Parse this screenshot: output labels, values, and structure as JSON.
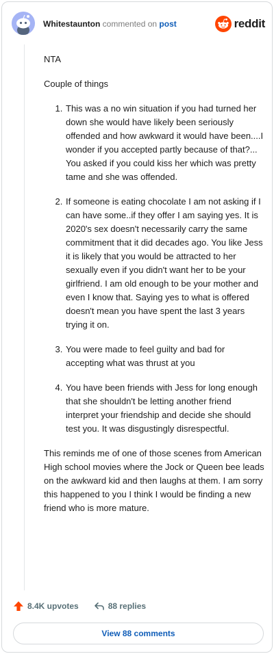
{
  "comment": {
    "username": "Whitestaunton",
    "action_text": "commented on",
    "post_link_label": "post",
    "paragraphs_before": [
      "NTA",
      "Couple of things"
    ],
    "list_items": [
      "This was a no win situation if you had turned her down she would have likely been seriously offended and how awkward it would have been....I wonder if you accepted partly because of that?... You asked if you could kiss her which was pretty tame and she was offended.",
      "If someone is eating chocolate I am not asking if I can have some..if they offer I am saying yes. It is 2020's sex doesn't necessarily carry the same commitment that it did decades ago. You like Jess it is likely that you would be attracted to her sexually even if you didn't want her to be your girlfriend. I am old enough to be your mother and even I know that. Saying yes to what is offered doesn't mean you have spent the last 3 years trying it on.",
      "You were made to feel guilty and bad for accepting what was thrust at you",
      "You have been friends with Jess for long enough that she shouldn't be letting another friend interpret your friendship and decide she should test you. It was disgustingly disrespectful."
    ],
    "closing_paragraph": "This reminds me of one of those scenes from American High school movies where the Jock or Queen bee leads on the awkward kid and then laughs at them. I am sorry this happened to you I think I would be finding a new friend who is more mature.",
    "upvotes_label": "8.4K upvotes",
    "replies_label": "88 replies",
    "view_comments_label": "View 88 comments"
  },
  "brand": {
    "name": "reddit",
    "color": "#ff4500"
  },
  "colors": {
    "link": "#0f5db8",
    "upvote": "#ff4500",
    "avatar": "#a5b4f5"
  },
  "icons": [
    "avatar",
    "reddit-logo-icon",
    "upvote-icon",
    "reply-icon"
  ]
}
